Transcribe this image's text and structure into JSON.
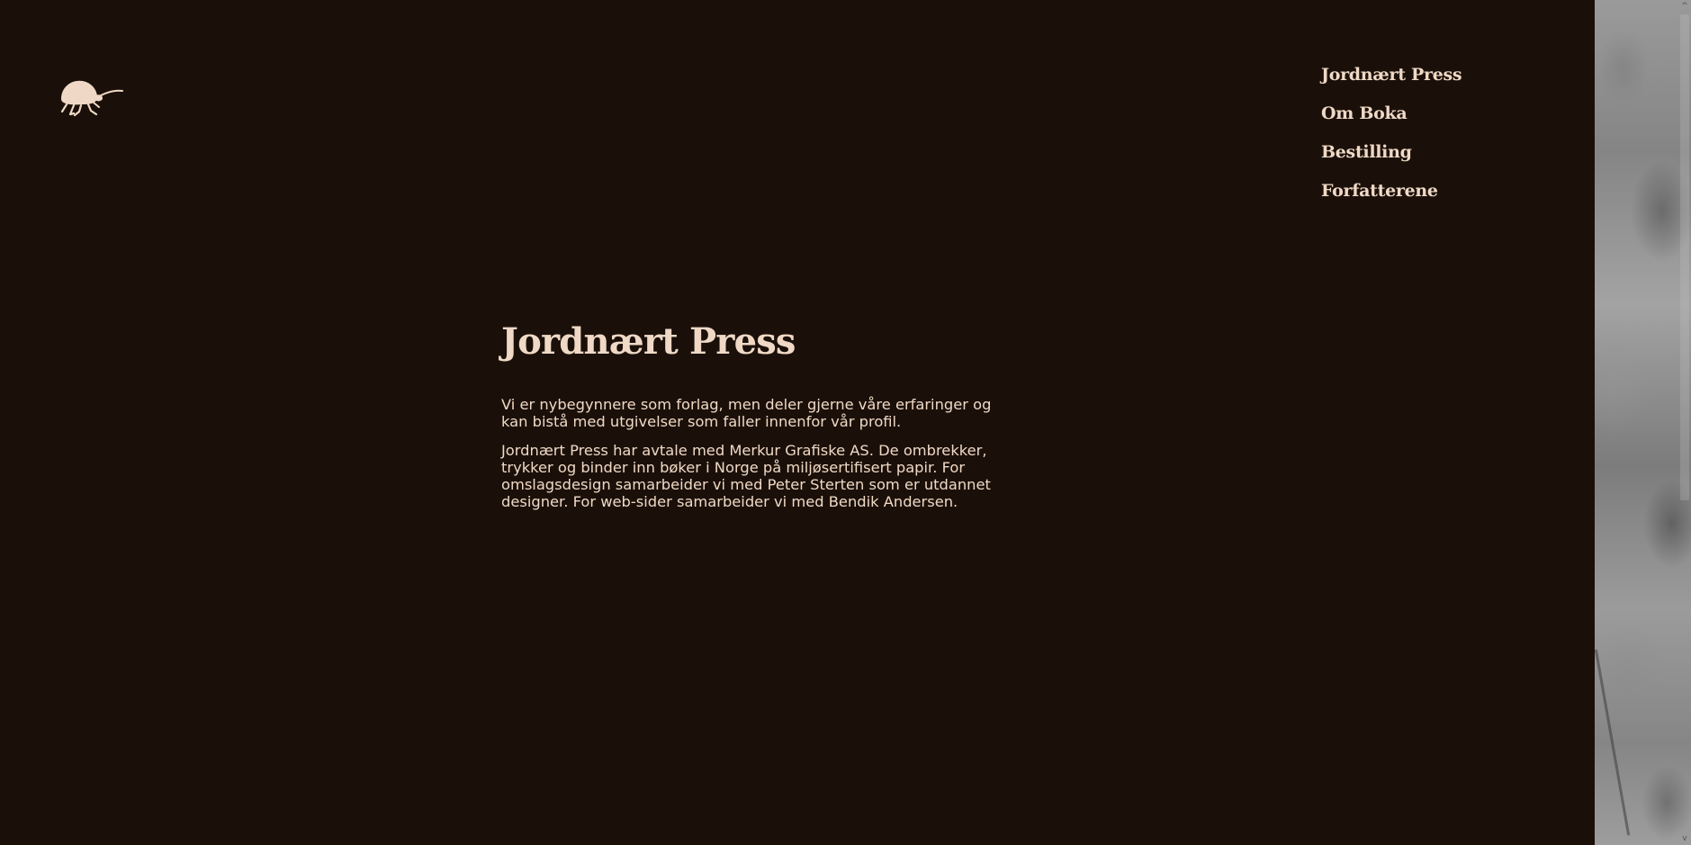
{
  "logo": {
    "icon": "beetle-icon",
    "color": "#efd9c6"
  },
  "nav": {
    "items": [
      {
        "label": "Jordnært Press"
      },
      {
        "label": "Om Boka"
      },
      {
        "label": "Bestilling"
      },
      {
        "label": "Forfatterene"
      }
    ]
  },
  "main": {
    "title": "Jordnært Press",
    "paragraphs": [
      "Vi er nybegynnere som forlag, men deler gjerne våre erfaringer og kan bistå med utgivelser som faller innenfor vår profil.",
      "Jordnært Press har avtale med Merkur Grafiske AS. De ombrekker, trykker og binder inn bøker i Norge på miljøsertifisert papir. For omslagsdesign samarbeider vi med Peter Sterten som er utdannet designer. For web-sider samarbeider vi med Bendik Andersen."
    ]
  },
  "scrollbar": {
    "up_icon": "chevron-up-icon",
    "down_icon": "chevron-down-icon",
    "up_glyph": "^",
    "down_glyph": "v"
  },
  "colors": {
    "background": "#1b1009",
    "text": "#efd9c6"
  }
}
